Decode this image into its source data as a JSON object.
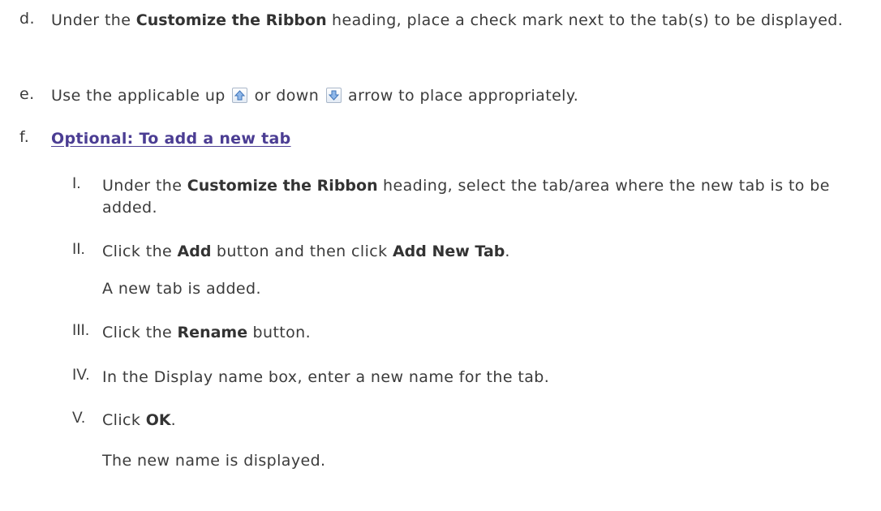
{
  "steps": {
    "d": {
      "letter": "d.",
      "pre": "Under the ",
      "bold": "Customize the Ribbon",
      "post": " heading, place a check mark next to the tab(s) to be displayed."
    },
    "e": {
      "letter": "e.",
      "pre": "Use the applicable up ",
      "mid": " or down ",
      "post": " arrow to place appropriately.",
      "up_icon": "move-up-arrow-icon",
      "down_icon": "move-down-arrow-icon"
    },
    "f": {
      "letter": "f.",
      "link": "Optional: To add a new tab"
    }
  },
  "substeps": [
    {
      "numeral": "I.",
      "pre": "Under the ",
      "bold": "Customize the Ribbon",
      "post": " heading, select the tab/area where the new tab is to be added."
    },
    {
      "numeral": "II.",
      "pre": "Click the ",
      "bold": "Add",
      "mid": " button and then click ",
      "bold2": "Add New Tab",
      "post": ".",
      "note": "A new tab is added."
    },
    {
      "numeral": "III.",
      "pre": "Click the ",
      "bold": "Rename",
      "post": " button."
    },
    {
      "numeral": "IV.",
      "text": "In the Display name box, enter a new name for the tab."
    },
    {
      "numeral": "V.",
      "pre": "Click ",
      "bold": "OK",
      "post": ".",
      "note": "The new name is displayed."
    }
  ],
  "colors": {
    "text": "#3b3b3b",
    "link": "#4b3d93",
    "icon_arrow": "#6f9fd8"
  }
}
